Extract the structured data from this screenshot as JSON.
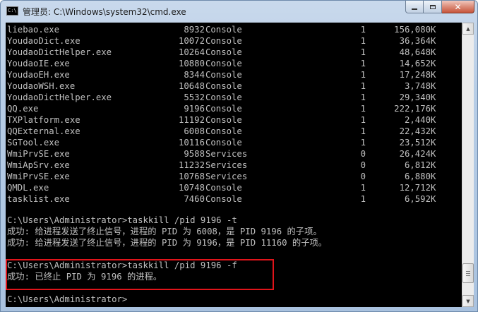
{
  "window": {
    "title": "管理员: C:\\Windows\\system32\\cmd.exe",
    "icon": "cmd-icon",
    "icon_text": "C:\\",
    "buttons": {
      "minimize": "minimize-icon",
      "maximize": "maximize-icon",
      "close_label": "✕"
    }
  },
  "colors": {
    "console_bg": "#000000",
    "console_text": "#c0c0c0",
    "highlight_border": "#e0141a"
  },
  "processes": [
    {
      "name": "liebao.exe",
      "pid": "8932",
      "session": "Console",
      "num": "1",
      "mem": "156,080",
      "unit": "K"
    },
    {
      "name": "YoudaoDict.exe",
      "pid": "10072",
      "session": "Console",
      "num": "1",
      "mem": "36,364",
      "unit": "K"
    },
    {
      "name": "YoudaoDictHelper.exe",
      "pid": "10264",
      "session": "Console",
      "num": "1",
      "mem": "48,648",
      "unit": "K"
    },
    {
      "name": "YoudaoIE.exe",
      "pid": "10880",
      "session": "Console",
      "num": "1",
      "mem": "14,652",
      "unit": "K"
    },
    {
      "name": "YoudaoEH.exe",
      "pid": "8344",
      "session": "Console",
      "num": "1",
      "mem": "17,248",
      "unit": "K"
    },
    {
      "name": "YoudaoWSH.exe",
      "pid": "10648",
      "session": "Console",
      "num": "1",
      "mem": "3,748",
      "unit": "K"
    },
    {
      "name": "YoudaoDictHelper.exe",
      "pid": "5532",
      "session": "Console",
      "num": "1",
      "mem": "29,340",
      "unit": "K"
    },
    {
      "name": "QQ.exe",
      "pid": "9196",
      "session": "Console",
      "num": "1",
      "mem": "222,176",
      "unit": "K"
    },
    {
      "name": "TXPlatform.exe",
      "pid": "11192",
      "session": "Console",
      "num": "1",
      "mem": "2,440",
      "unit": "K"
    },
    {
      "name": "QQExternal.exe",
      "pid": "6008",
      "session": "Console",
      "num": "1",
      "mem": "22,432",
      "unit": "K"
    },
    {
      "name": "SGTool.exe",
      "pid": "10116",
      "session": "Console",
      "num": "1",
      "mem": "23,512",
      "unit": "K"
    },
    {
      "name": "WmiPrvSE.exe",
      "pid": "9588",
      "session": "Services",
      "num": "0",
      "mem": "26,424",
      "unit": "K"
    },
    {
      "name": "WmiApSrv.exe",
      "pid": "11232",
      "session": "Services",
      "num": "0",
      "mem": "6,812",
      "unit": "K"
    },
    {
      "name": "WmiPrvSE.exe",
      "pid": "10768",
      "session": "Services",
      "num": "0",
      "mem": "6,880",
      "unit": "K"
    },
    {
      "name": "QMDL.exe",
      "pid": "10748",
      "session": "Console",
      "num": "1",
      "mem": "12,712",
      "unit": "K"
    },
    {
      "name": "tasklist.exe",
      "pid": "7460",
      "session": "Console",
      "num": "1",
      "mem": "6,592",
      "unit": "K"
    }
  ],
  "output": {
    "cmd1": "C:\\Users\\Administrator>taskkill /pid 9196 -t",
    "cmd1_result1": "成功: 给进程发送了终止信号，进程的 PID 为 6008，是 PID 9196 的子项。",
    "cmd1_result2": "成功: 给进程发送了终止信号，进程的 PID 为 9196，是 PID 11160 的子项。",
    "cmd2": "C:\\Users\\Administrator>taskkill /pid 9196 -f",
    "cmd2_result": "成功: 已终止 PID 为 9196 的进程。",
    "prompt": "C:\\Users\\Administrator>"
  },
  "scrollbar": {
    "up_arrow": "▲",
    "down_arrow": "▼",
    "position_fraction": 0.95
  }
}
